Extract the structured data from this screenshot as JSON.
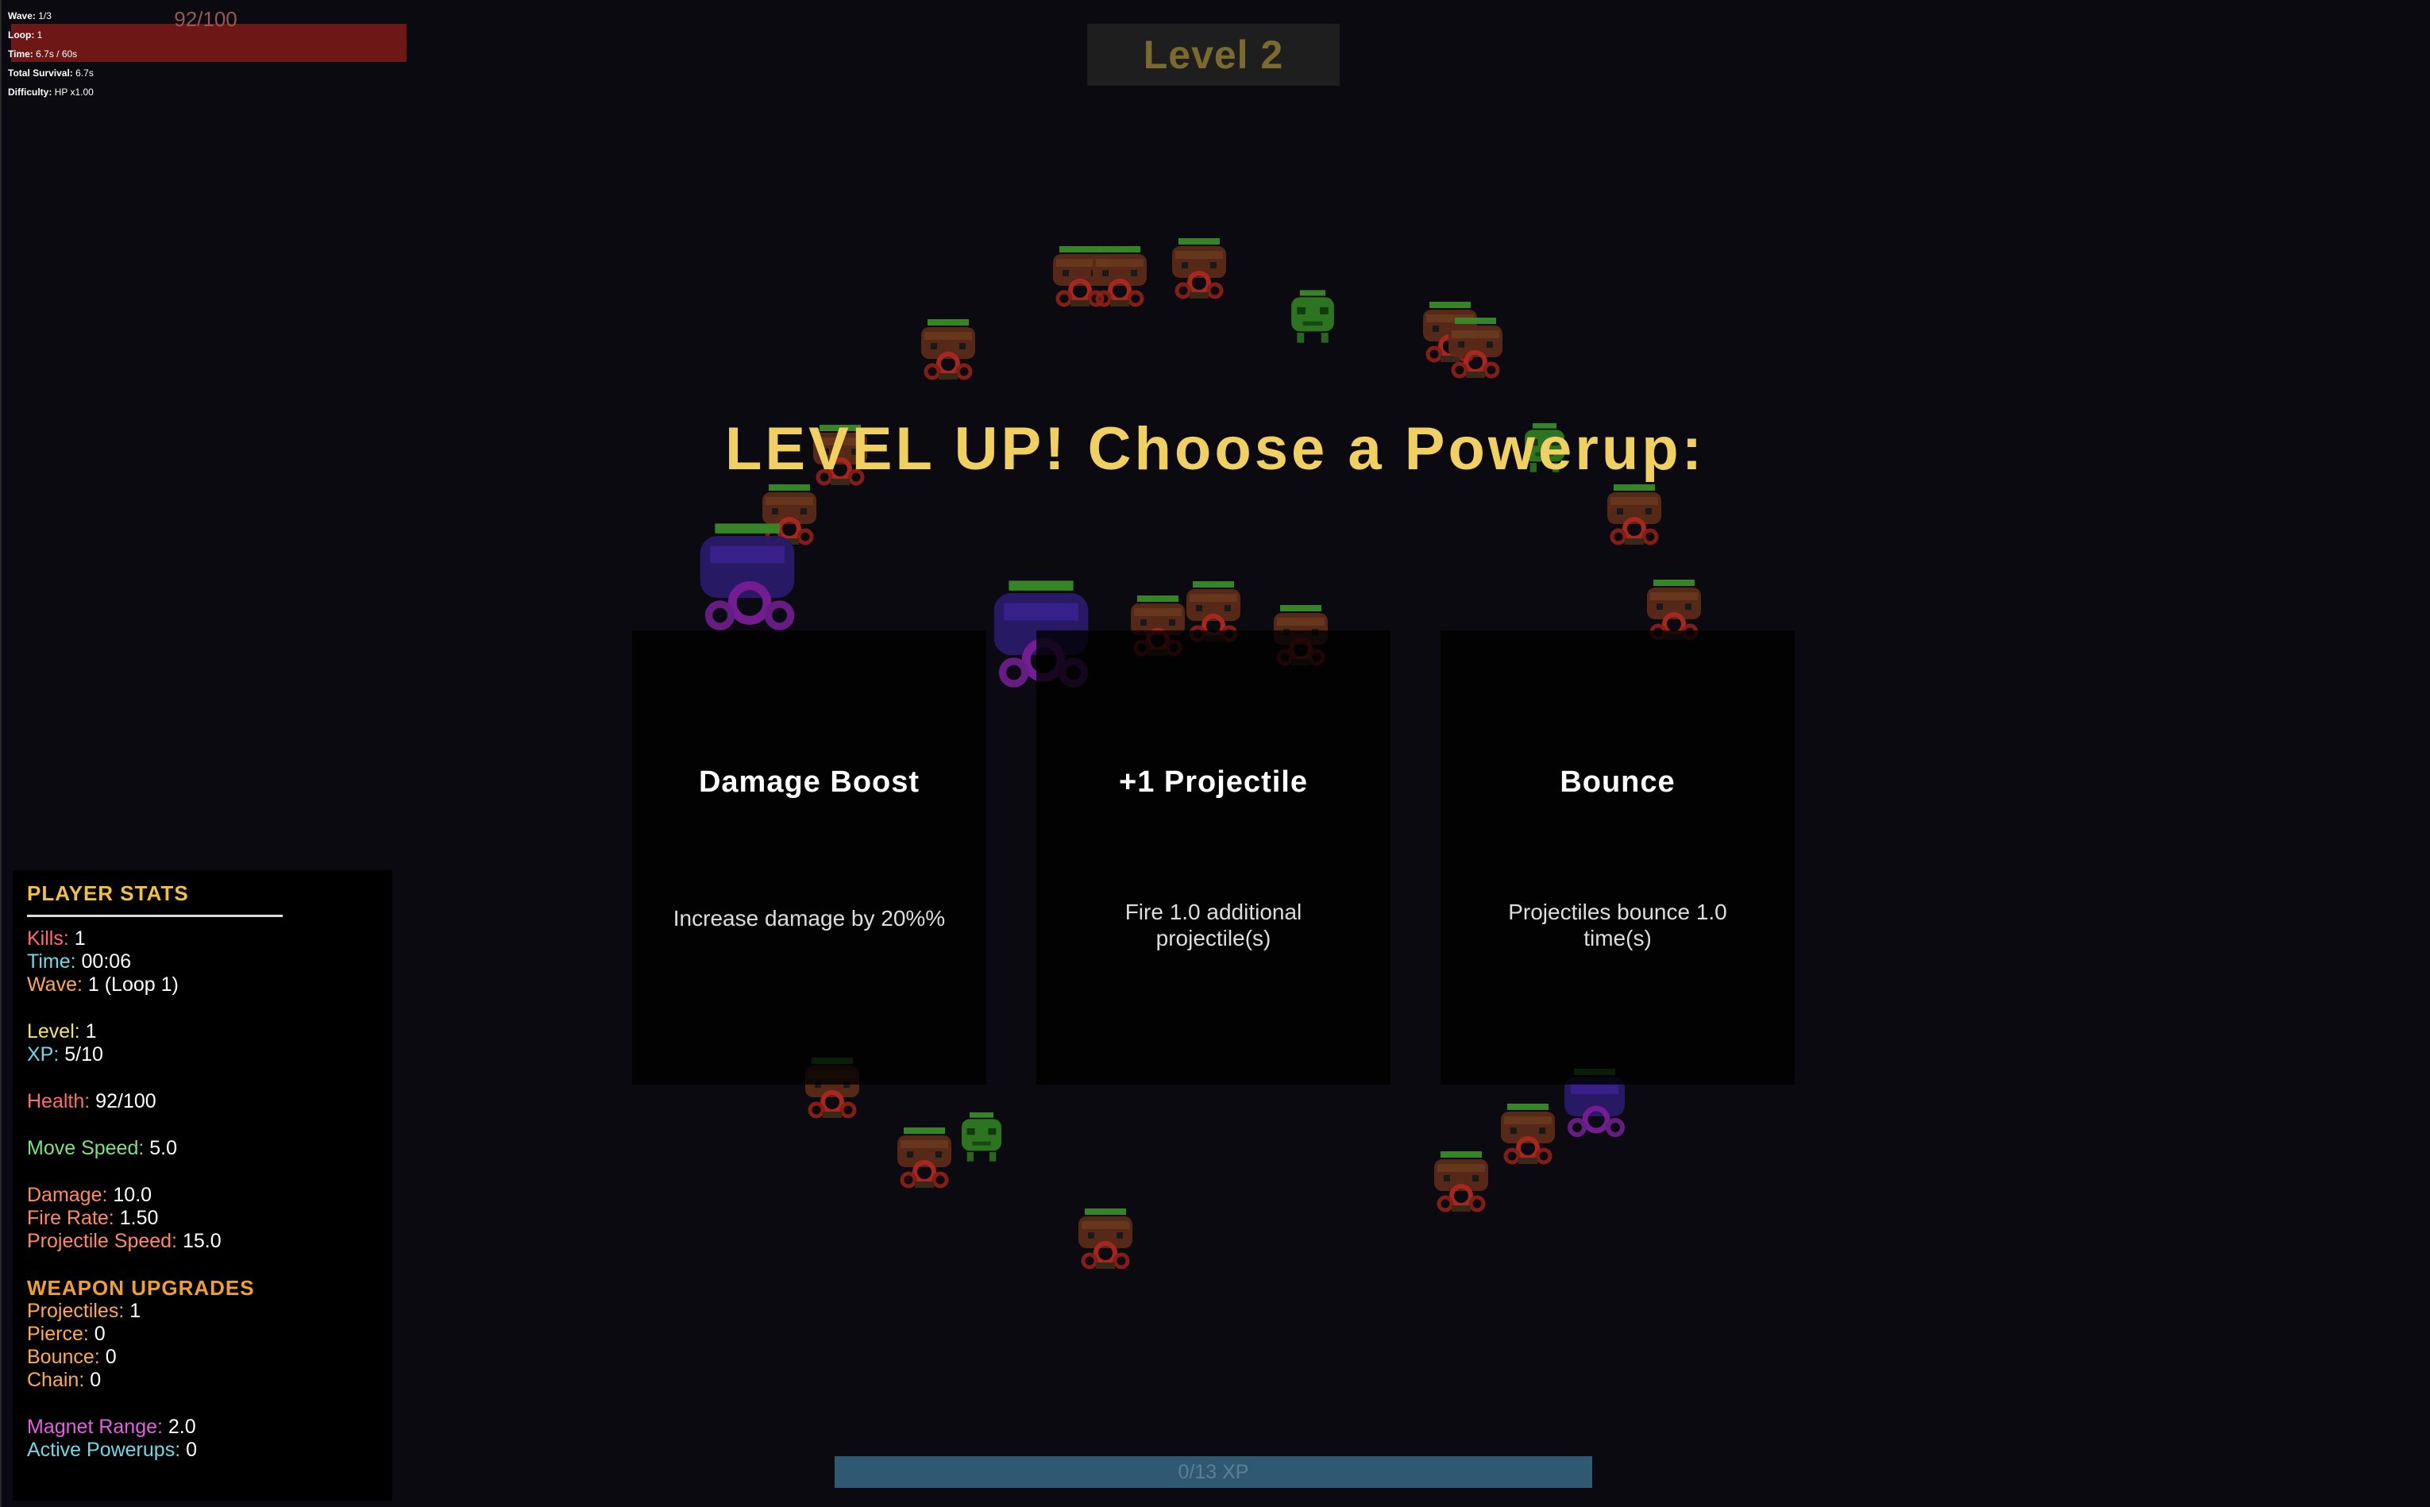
{
  "hud": {
    "wave": {
      "label": "Wave:",
      "value": "1/3"
    },
    "loop": {
      "label": "Loop:",
      "value": "1"
    },
    "time": {
      "label": "Time:",
      "value": "6.7s / 60s"
    },
    "total_survival": {
      "label": "Total Survival:",
      "value": "6.7s"
    },
    "difficulty": {
      "label": "Difficulty:",
      "value": "HP x1.00"
    },
    "health_bar_text": "92/100",
    "health_fraction": 0.92,
    "level_label": "Level 2"
  },
  "level_up": {
    "title": "LEVEL UP! Choose a Powerup:",
    "cards": [
      {
        "title": "Damage Boost",
        "desc": "Increase damage by 20%%"
      },
      {
        "title": "+1 Projectile",
        "desc": "Fire 1.0 additional projectile(s)"
      },
      {
        "title": "Bounce",
        "desc": "Projectiles bounce 1.0 time(s)"
      }
    ]
  },
  "stats": {
    "player_header": "PLAYER STATS",
    "kills": {
      "label": "Kills:",
      "value": "1"
    },
    "time": {
      "label": "Time:",
      "value": "00:06"
    },
    "wave": {
      "label": "Wave:",
      "value": "1 (Loop 1)"
    },
    "level": {
      "label": "Level:",
      "value": "1"
    },
    "xp": {
      "label": "XP:",
      "value": "5/10"
    },
    "health": {
      "label": "Health:",
      "value": "92/100"
    },
    "move_speed": {
      "label": "Move Speed:",
      "value": "5.0"
    },
    "damage": {
      "label": "Damage:",
      "value": "10.0"
    },
    "fire_rate": {
      "label": "Fire Rate:",
      "value": "1.50"
    },
    "projectile_speed": {
      "label": "Projectile Speed:",
      "value": "15.0"
    },
    "weapon_header": "WEAPON UPGRADES",
    "projectiles": {
      "label": "Projectiles:",
      "value": "1"
    },
    "pierce": {
      "label": "Pierce:",
      "value": "0"
    },
    "bounce": {
      "label": "Bounce:",
      "value": "0"
    },
    "chain": {
      "label": "Chain:",
      "value": "0"
    },
    "magnet_range": {
      "label": "Magnet Range:",
      "value": "2.0"
    },
    "active_powerups": {
      "label": "Active Powerups:",
      "value": "0"
    }
  },
  "xp_bar": {
    "text": "0/13 XP",
    "fraction": 0
  },
  "colors": {
    "red_label": "#ff6b6b",
    "cyan_label": "#6fd9e6",
    "orange_label": "#ffa94d",
    "yellow_label": "#f5e55a",
    "green_label": "#7ee07e",
    "magenta_label": "#e060e0",
    "gold_header": "#f0c040",
    "title_yellow": "#f0d060"
  },
  "enemies": {
    "types": [
      "red-enemy",
      "green-enemy",
      "purple-enemy"
    ]
  }
}
